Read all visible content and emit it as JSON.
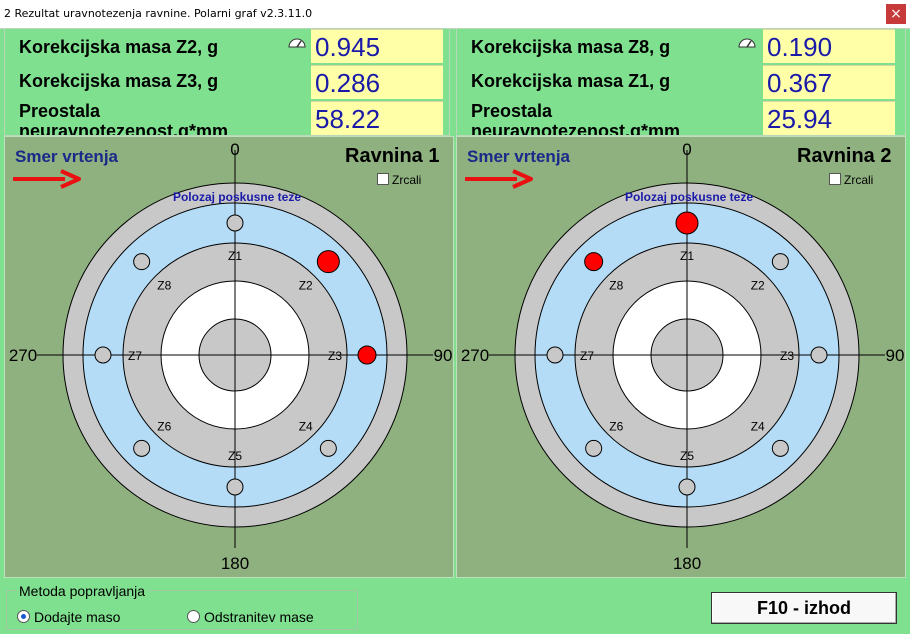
{
  "window": {
    "title": "2 Rezultat uravnotezenja ravnine. Polarni graf v2.3.11.0",
    "close": "×"
  },
  "left": {
    "rows": [
      {
        "label": "Korekcijska masa Z2, g",
        "value": "0.945"
      },
      {
        "label": "Korekcijska masa Z3, g",
        "value": "0.286"
      },
      {
        "label": "Preostala neuravnotezenost,g*mm",
        "value": "58.22"
      }
    ],
    "plane": {
      "smer": "Smer vrtenja",
      "title": "Ravnina 1",
      "mirror": "Zrcali",
      "trial": "Polozaj poskusne teze",
      "angles": {
        "top": "0",
        "right": "90",
        "bottom": "180",
        "left": "270"
      },
      "zones": [
        "Z1",
        "Z2",
        "Z3",
        "Z4",
        "Z5",
        "Z6",
        "Z7",
        "Z8"
      ],
      "red_large": "Z2",
      "red_small": "Z3"
    }
  },
  "right": {
    "rows": [
      {
        "label": "Korekcijska masa Z8, g",
        "value": "0.190"
      },
      {
        "label": "Korekcijska masa Z1, g",
        "value": "0.367"
      },
      {
        "label": "Preostala neuravnotezenost,g*mm",
        "value": "25.94"
      }
    ],
    "plane": {
      "smer": "Smer vrtenja",
      "title": "Ravnina 2",
      "mirror": "Zrcali",
      "trial": "Polozaj poskusne teze",
      "angles": {
        "top": "0",
        "right": "90",
        "bottom": "180",
        "left": "270"
      },
      "zones": [
        "Z1",
        "Z2",
        "Z3",
        "Z4",
        "Z5",
        "Z6",
        "Z7",
        "Z8"
      ],
      "red_large": "Z1",
      "red_small": "Z8"
    }
  },
  "bottom": {
    "group_title": "Metoda popravljanja",
    "option_add": "Dodajte maso",
    "option_remove": "Odstranitev mase",
    "exit": "F10 - izhod"
  },
  "colors": {
    "background": "#7fe08f",
    "graph_bg": "#8fb07f",
    "value_bg": "#ffffa8",
    "ring_gray": "#c8c8c8",
    "ring_blue": "#b4dcf6",
    "red": "#ff0000"
  }
}
